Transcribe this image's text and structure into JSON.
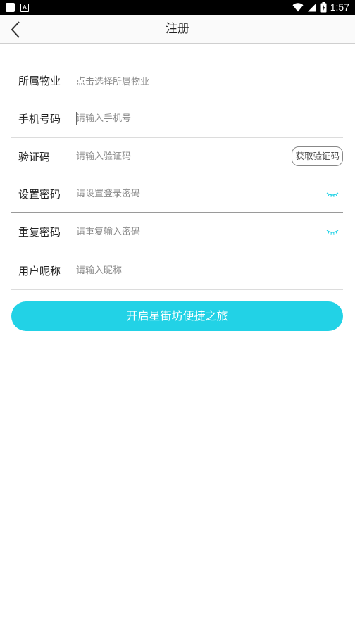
{
  "status_bar": {
    "time": "1:57"
  },
  "nav": {
    "title": "注册"
  },
  "form": {
    "property": {
      "label": "所属物业",
      "value": "点击选择所属物业"
    },
    "phone": {
      "label": "手机号码",
      "placeholder": "请输入手机号"
    },
    "code": {
      "label": "验证码",
      "placeholder": "请输入验证码",
      "button": "获取验证码"
    },
    "password": {
      "label": "设置密码",
      "placeholder": "请设置登录密码"
    },
    "repeat_password": {
      "label": "重复密码",
      "placeholder": "请重复输入密码"
    },
    "nickname": {
      "label": "用户昵称",
      "placeholder": "请输入昵称"
    }
  },
  "submit": {
    "label": "开启星街坊便捷之旅"
  },
  "colors": {
    "accent": "#22d2e6",
    "status_bar": "#000000",
    "divider": "#dcdcdc"
  },
  "icons": {
    "back": "chevron-left-icon",
    "eye": "eye-closed-icon",
    "wifi": "wifi-icon",
    "signal": "signal-icon",
    "battery": "battery-icon"
  }
}
